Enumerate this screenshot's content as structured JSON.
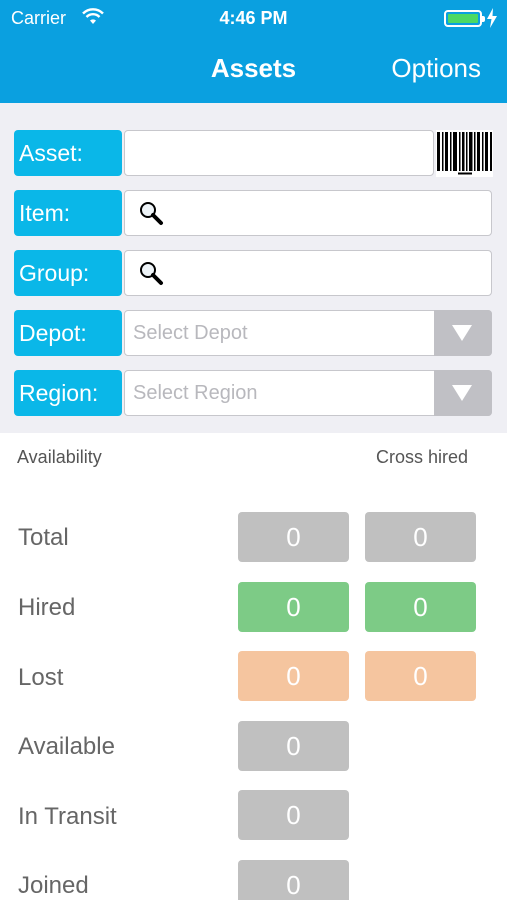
{
  "status_bar": {
    "carrier": "Carrier",
    "time": "4:46 PM"
  },
  "nav": {
    "title": "Assets",
    "options_label": "Options"
  },
  "form": {
    "asset_label": "Asset:",
    "asset_value": "",
    "item_label": "Item:",
    "item_value": "",
    "group_label": "Group:",
    "group_value": "",
    "depot_label": "Depot:",
    "depot_placeholder": "Select Depot",
    "region_label": "Region:",
    "region_placeholder": "Select Region"
  },
  "availability": {
    "heading": "Availability",
    "cross_hired_heading": "Cross hired",
    "rows": [
      {
        "label": "Total",
        "value": "0",
        "cross": "0",
        "color": "#c0c0c0"
      },
      {
        "label": "Hired",
        "value": "0",
        "cross": "0",
        "color": "#7dcb86"
      },
      {
        "label": "Lost",
        "value": "0",
        "cross": "0",
        "color": "#f5c59f"
      },
      {
        "label": "Available",
        "value": "0",
        "color": "#c0c0c0"
      },
      {
        "label": "In Transit",
        "value": "0",
        "color": "#c0c0c0"
      },
      {
        "label": "Joined",
        "value": "0",
        "color": "#c0c0c0"
      }
    ]
  },
  "colors": {
    "header": "#0aa0e0",
    "label_bg": "#0ab7e8"
  }
}
